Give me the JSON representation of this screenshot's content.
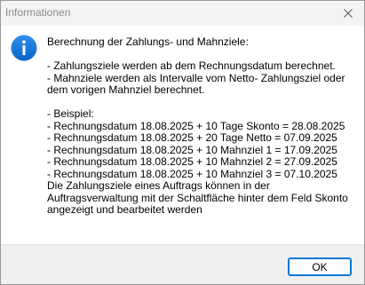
{
  "window": {
    "title": "Informationen",
    "close_icon": "close-icon"
  },
  "message": {
    "icon": "info-icon",
    "lines": [
      "Berechnung der Zahlungs- und Mahnziele:",
      "",
      "- Zahlungsziele werden ab dem Rechnungsdatum berechnet.",
      "- Mahnziele werden als Intervalle vom Netto- Zahlungsziel oder",
      "dem vorigen Mahnziel berechnet.",
      "",
      "- Beispiel:",
      "- Rechnungsdatum 18.08.2025 + 10 Tage Skonto = 28.08.2025",
      "- Rechnungsdatum 18.08.2025 + 20 Tage Netto  = 07.09.2025",
      "- Rechnungsdatum 18.08.2025 + 10 Mahnziel 1 = 17.09.2025",
      "- Rechnungsdatum 18.08.2025 + 10 Mahnziel 2 = 27.09.2025",
      "- Rechnungsdatum 18.08.2025 + 10 Mahnziel 3 = 07.10.2025",
      "Die Zahlungsziele eines Auftrags können in der",
      "Auftragsverwaltung mit der Schaltfläche hinter dem Feld Skonto",
      "angezeigt und bearbeitet werden"
    ]
  },
  "footer": {
    "ok_label": "OK"
  },
  "colors": {
    "accent": "#0078d4",
    "footer_bg": "#f0f0f0",
    "titlebar_bg": "#f3f3f3"
  }
}
